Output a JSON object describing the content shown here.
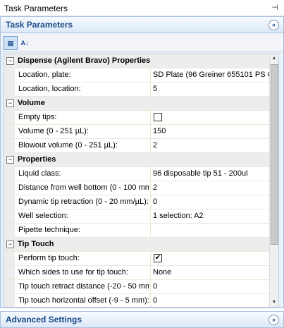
{
  "window": {
    "title": "Task Parameters",
    "pin_glyph": "⊣"
  },
  "panel": {
    "header": "Task Parameters",
    "collapse_glyph": "«"
  },
  "toolbar": {
    "categorized_glyph": "▤",
    "alphabetical_glyph": "A↓"
  },
  "grid": {
    "rows": [
      {
        "kind": "cat",
        "label": "Dispense (Agilent Bravo) Properties",
        "toggle": "−"
      },
      {
        "kind": "prop",
        "label": "Location, plate:",
        "value": "SD Plate  (96 Greiner 655101 PS Clr"
      },
      {
        "kind": "prop",
        "label": "Location, location:",
        "value": "5"
      },
      {
        "kind": "cat",
        "label": "Volume",
        "toggle": "−"
      },
      {
        "kind": "prop",
        "label": "Empty tips:",
        "checkbox": true,
        "checked": false
      },
      {
        "kind": "prop",
        "label": "Volume (0 - 251 µL):",
        "value": "150"
      },
      {
        "kind": "prop",
        "label": "Blowout volume (0 - 251 µL):",
        "value": "2"
      },
      {
        "kind": "cat",
        "label": "Properties",
        "toggle": "−"
      },
      {
        "kind": "prop",
        "label": "Liquid class:",
        "value": "96 disposable tip 51 - 200ul"
      },
      {
        "kind": "prop",
        "label": "Distance from well bottom (0 - 100 mm",
        "value": "2"
      },
      {
        "kind": "prop",
        "label": "Dynamic tip retraction (0 - 20 mm/µL):",
        "value": "0"
      },
      {
        "kind": "prop",
        "label": "Well selection:",
        "value": "1 selection: A2"
      },
      {
        "kind": "prop",
        "label": "Pipette technique:",
        "value": ""
      },
      {
        "kind": "cat",
        "label": "Tip Touch",
        "toggle": "−"
      },
      {
        "kind": "prop",
        "label": "Perform tip touch:",
        "checkbox": true,
        "checked": true
      },
      {
        "kind": "prop",
        "label": "Which sides to use for tip touch:",
        "value": "None"
      },
      {
        "kind": "prop",
        "label": "Tip touch retract distance (-20 - 50 mm",
        "value": "0"
      },
      {
        "kind": "prop",
        "label": "Tip touch horizontal offset (-9 - 5 mm):",
        "value": "0"
      }
    ]
  },
  "scrollbar": {
    "up_glyph": "▲",
    "down_glyph": "▼"
  },
  "advanced": {
    "header": "Advanced Settings",
    "expand_glyph": "»"
  }
}
